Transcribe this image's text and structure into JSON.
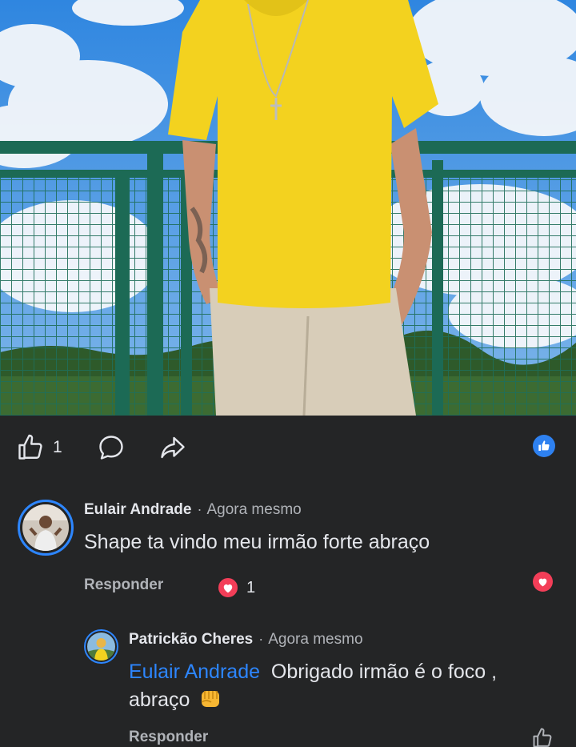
{
  "post": {
    "like_count": "1",
    "reaction_color": "#2e81f0"
  },
  "comments": [
    {
      "author": "Eulair Andrade",
      "separator": "·",
      "timestamp": "Agora mesmo",
      "text": "Shape ta vindo meu irmão forte abraço",
      "reply_label": "Responder",
      "reaction_count": "1",
      "reaction_icon": "heart-icon"
    },
    {
      "author": "Patrickão Cheres",
      "separator": "·",
      "timestamp": "Agora mesmo",
      "mention": "Eulair Andrade",
      "text": "Obrigado irmão é o foco ,",
      "text_line2": "abraço",
      "emoji": "oncoming-fist-icon",
      "reply_label": "Responder"
    }
  ],
  "colors": {
    "background": "#242526",
    "accent": "#2d86ff",
    "heart": "#f33e58",
    "secondary_text": "#b0b3b8"
  }
}
